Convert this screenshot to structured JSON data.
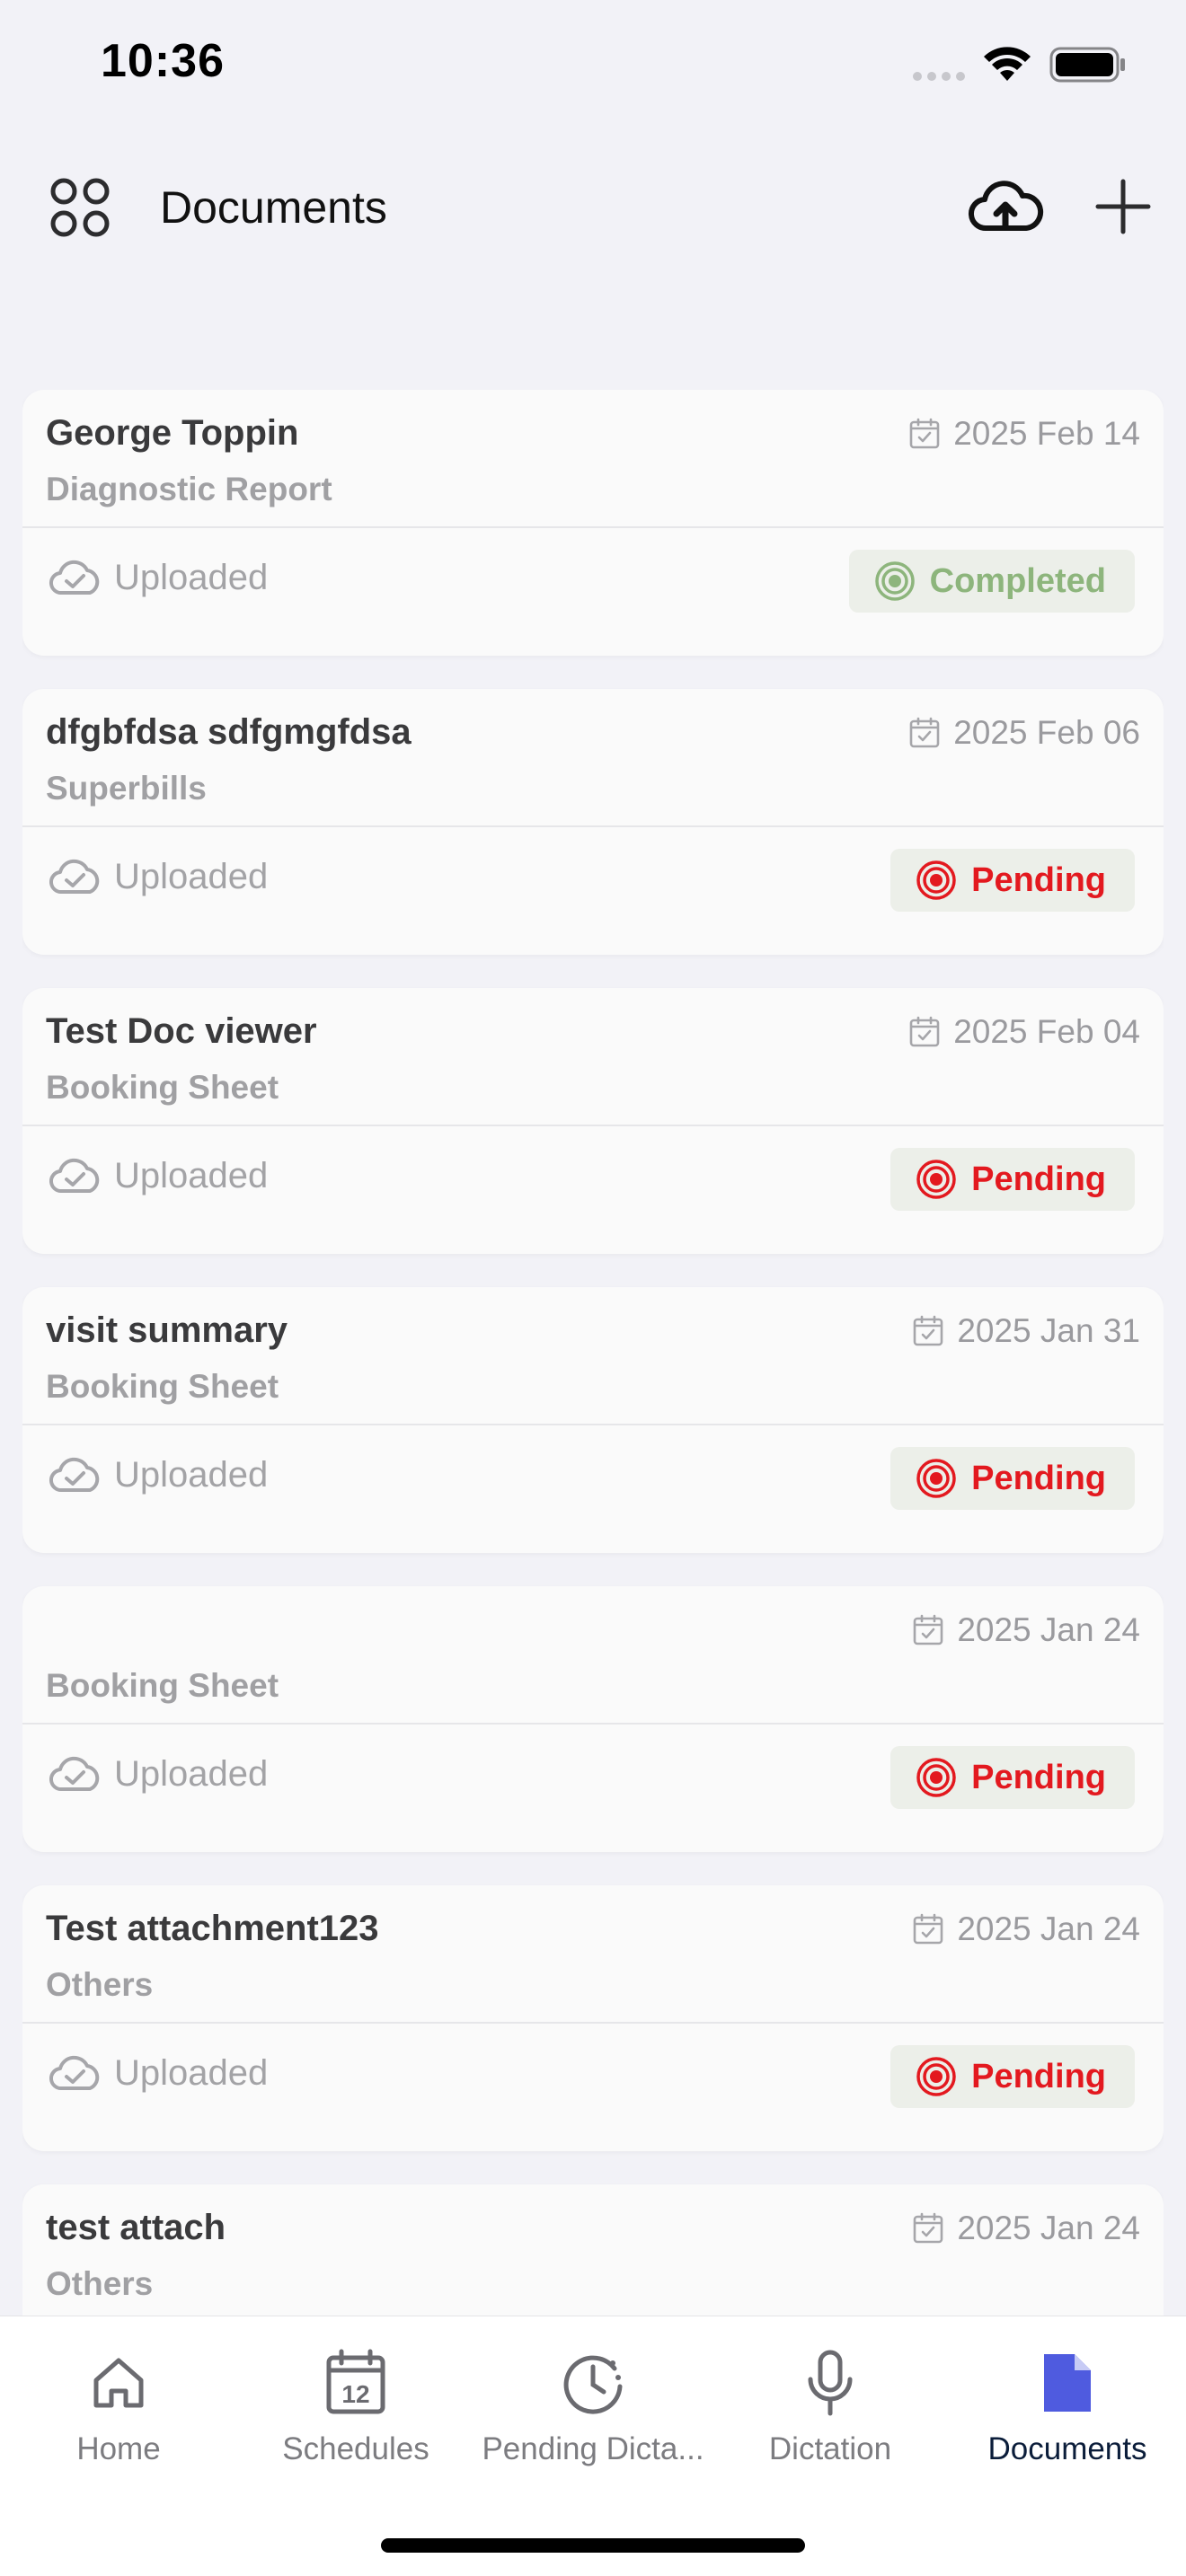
{
  "status_bar": {
    "time": "10:36"
  },
  "header": {
    "title": "Documents",
    "menu_icon": "grid-menu-icon",
    "upload_icon": "cloud-upload-icon",
    "add_icon": "plus-icon"
  },
  "documents": [
    {
      "name": "George Toppin",
      "type": "Diagnostic Report",
      "date": "2025 Feb 14",
      "upload_status": "Uploaded",
      "status": "Completed",
      "status_kind": "completed"
    },
    {
      "name": "dfgbfdsa sdfgmgfdsa",
      "type": "Superbills",
      "date": "2025 Feb 06",
      "upload_status": "Uploaded",
      "status": "Pending",
      "status_kind": "pending"
    },
    {
      "name": "Test Doc viewer",
      "type": "Booking Sheet",
      "date": "2025 Feb 04",
      "upload_status": "Uploaded",
      "status": "Pending",
      "status_kind": "pending"
    },
    {
      "name": "visit summary",
      "type": "Booking Sheet",
      "date": "2025 Jan 31",
      "upload_status": "Uploaded",
      "status": "Pending",
      "status_kind": "pending"
    },
    {
      "name": "",
      "type": "Booking Sheet",
      "date": "2025 Jan 24",
      "upload_status": "Uploaded",
      "status": "Pending",
      "status_kind": "pending"
    },
    {
      "name": "Test attachment123",
      "type": "Others",
      "date": "2025 Jan 24",
      "upload_status": "Uploaded",
      "status": "Pending",
      "status_kind": "pending"
    },
    {
      "name": "test attach",
      "type": "Others",
      "date": "2025 Jan 24",
      "upload_status": "",
      "status": "",
      "status_kind": ""
    }
  ],
  "tabs": [
    {
      "label": "Home",
      "icon": "home-icon",
      "active": false
    },
    {
      "label": "Schedules",
      "icon": "calendar-icon",
      "active": false
    },
    {
      "label": "Pending Dicta...",
      "icon": "clock-history-icon",
      "active": false
    },
    {
      "label": "Dictation",
      "icon": "microphone-icon",
      "active": false
    },
    {
      "label": "Documents",
      "icon": "document-icon",
      "active": true
    }
  ],
  "colors": {
    "pending": "#e3191f",
    "completed": "#8db57c",
    "active_tab": "#4f5bdf",
    "badge_bg": "#ecefe9"
  }
}
